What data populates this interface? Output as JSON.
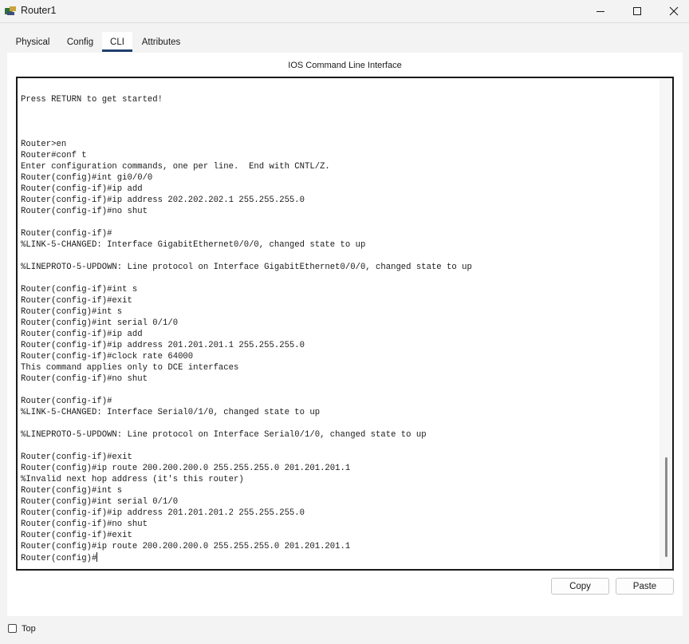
{
  "window": {
    "title": "Router1",
    "icon": "router-app-icon",
    "controls": [
      "minimize-icon",
      "maximize-icon",
      "close-icon"
    ]
  },
  "tabs": [
    {
      "label": "Physical",
      "active": false
    },
    {
      "label": "Config",
      "active": false
    },
    {
      "label": "CLI",
      "active": true
    },
    {
      "label": "Attributes",
      "active": false
    }
  ],
  "cli": {
    "heading": "IOS Command Line Interface",
    "lines": [
      "",
      "Press RETURN to get started!",
      "",
      "",
      "",
      "Router>en",
      "Router#conf t",
      "Enter configuration commands, one per line.  End with CNTL/Z.",
      "Router(config)#int gi0/0/0",
      "Router(config-if)#ip add",
      "Router(config-if)#ip address 202.202.202.1 255.255.255.0",
      "Router(config-if)#no shut",
      "",
      "Router(config-if)#",
      "%LINK-5-CHANGED: Interface GigabitEthernet0/0/0, changed state to up",
      "",
      "%LINEPROTO-5-UPDOWN: Line protocol on Interface GigabitEthernet0/0/0, changed state to up",
      "",
      "Router(config-if)#int s",
      "Router(config-if)#exit",
      "Router(config)#int s",
      "Router(config)#int serial 0/1/0",
      "Router(config-if)#ip add",
      "Router(config-if)#ip address 201.201.201.1 255.255.255.0",
      "Router(config-if)#clock rate 64000",
      "This command applies only to DCE interfaces",
      "Router(config-if)#no shut",
      "",
      "Router(config-if)#",
      "%LINK-5-CHANGED: Interface Serial0/1/0, changed state to up",
      "",
      "%LINEPROTO-5-UPDOWN: Line protocol on Interface Serial0/1/0, changed state to up",
      "",
      "Router(config-if)#exit",
      "Router(config)#ip route 200.200.200.0 255.255.255.0 201.201.201.1",
      "%Invalid next hop address (it's this router)",
      "Router(config)#int s",
      "Router(config)#int serial 0/1/0",
      "Router(config-if)#ip address 201.201.201.2 255.255.255.0",
      "Router(config-if)#no shut",
      "Router(config-if)#exit",
      "Router(config)#ip route 200.200.200.0 255.255.255.0 201.201.201.1"
    ],
    "prompt": "Router(config)#"
  },
  "buttons": {
    "copy": "Copy",
    "paste": "Paste"
  },
  "footer": {
    "top_checkbox_label": "Top",
    "top_checked": false
  },
  "colors": {
    "tab_underline": "#1f3f6e",
    "terminal_border": "#1a1a1a"
  }
}
